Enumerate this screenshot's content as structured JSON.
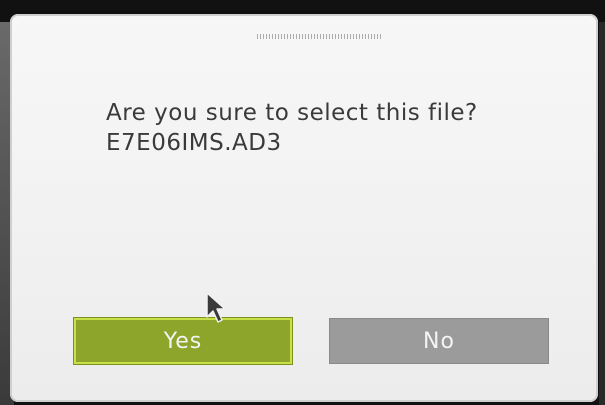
{
  "dialog": {
    "message_line1": "Are you sure to select this file?",
    "message_line2": "E7E06IMS.AD3"
  },
  "buttons": {
    "yes_label": "Yes",
    "no_label": "No"
  },
  "colors": {
    "yes_button": "#8da52a",
    "yes_border": "#c8df4a",
    "no_button": "#9b9b9b",
    "dialog_bg": "#f1f1f1",
    "text": "#3a3a3a"
  },
  "icons": {
    "pointer": "mouse-pointer-icon"
  }
}
